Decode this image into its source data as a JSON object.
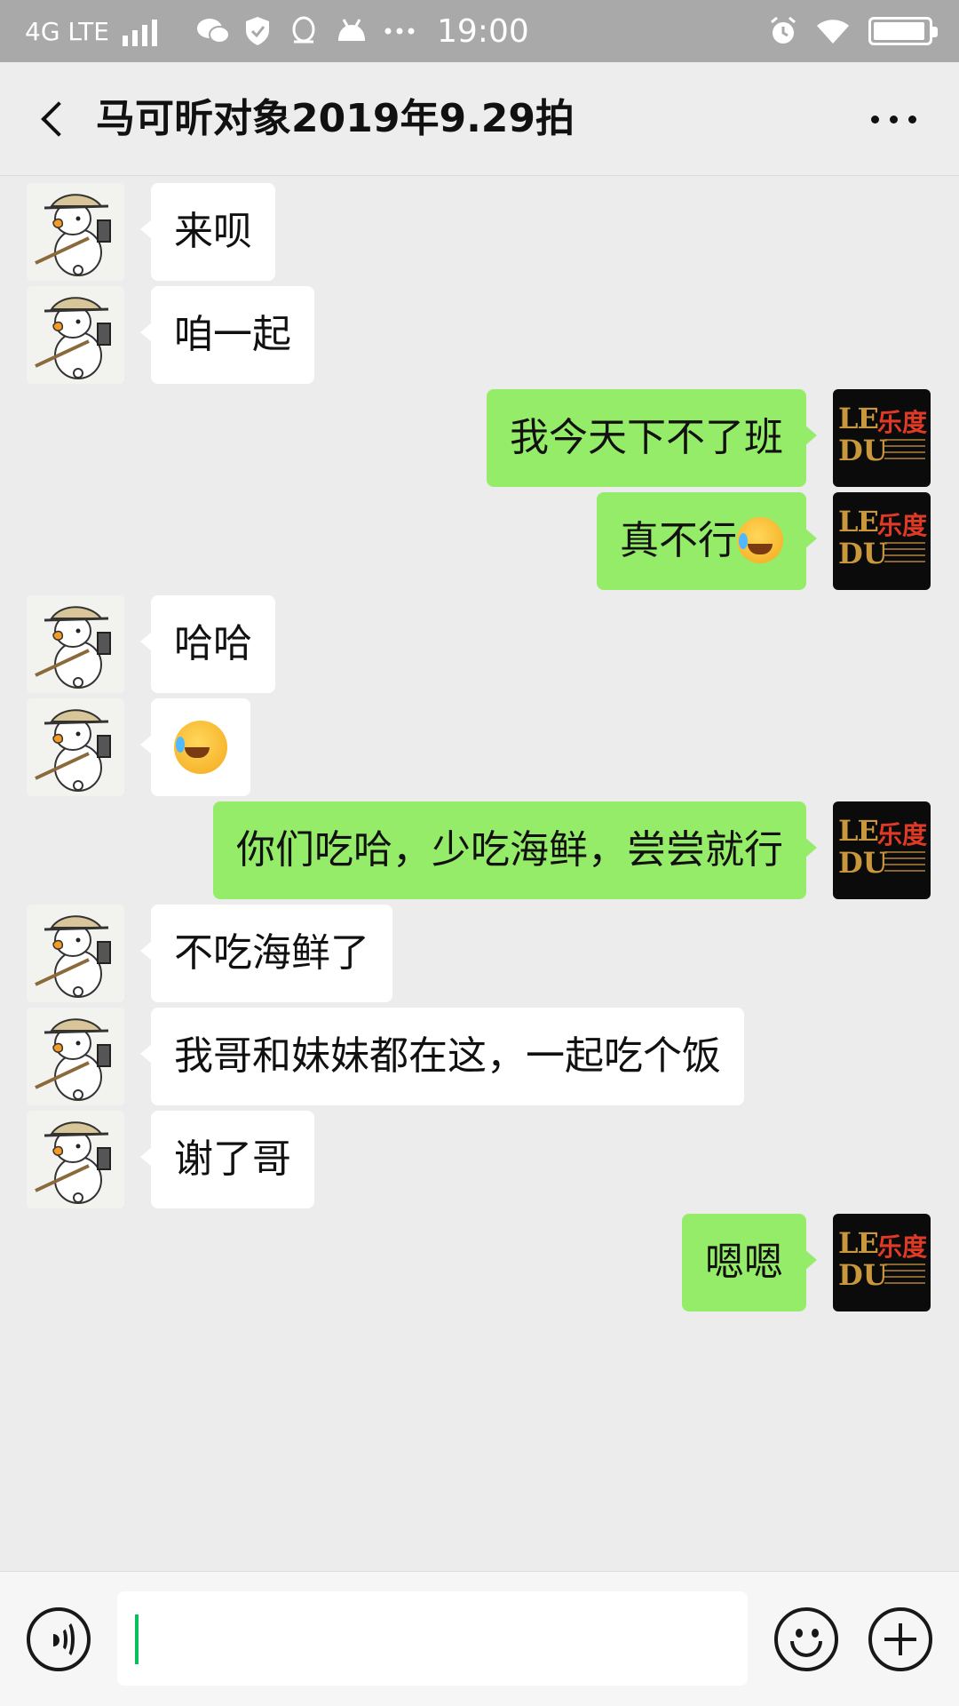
{
  "status_bar": {
    "network": "4G LTE",
    "time": "19:00",
    "battery_level": 0.95
  },
  "header": {
    "title": "马可昕对象2019年9.29拍"
  },
  "messages": [
    {
      "side": "in",
      "text": "来呗"
    },
    {
      "side": "in",
      "text": "咱一起"
    },
    {
      "side": "out",
      "text": "我今天下不了班"
    },
    {
      "side": "out",
      "text": "真不行",
      "emoji": "laugh-cry-emoji"
    },
    {
      "side": "in",
      "text": "哈哈"
    },
    {
      "side": "in",
      "text": "",
      "emoji": "laugh-cry-emoji"
    },
    {
      "side": "out",
      "text": "你们吃哈，少吃海鲜，尝尝就行"
    },
    {
      "side": "in",
      "text": "不吃海鲜了"
    },
    {
      "side": "in",
      "text": "我哥和妹妹都在这，一起吃个饭"
    },
    {
      "side": "in",
      "text": "谢了哥"
    },
    {
      "side": "out",
      "text": "嗯嗯"
    }
  ],
  "avatars": {
    "self_logo": {
      "main": "LE",
      "second": "DU",
      "chinese": "乐度"
    },
    "other": "duck-hat-avatar"
  },
  "colors": {
    "incoming_bubble": "#ffffff",
    "outgoing_bubble": "#95ec69",
    "background": "#ececec",
    "cursor": "#07c160",
    "logo_gold": "#c9973c",
    "logo_red": "#e03a26"
  },
  "input": {
    "value": ""
  }
}
